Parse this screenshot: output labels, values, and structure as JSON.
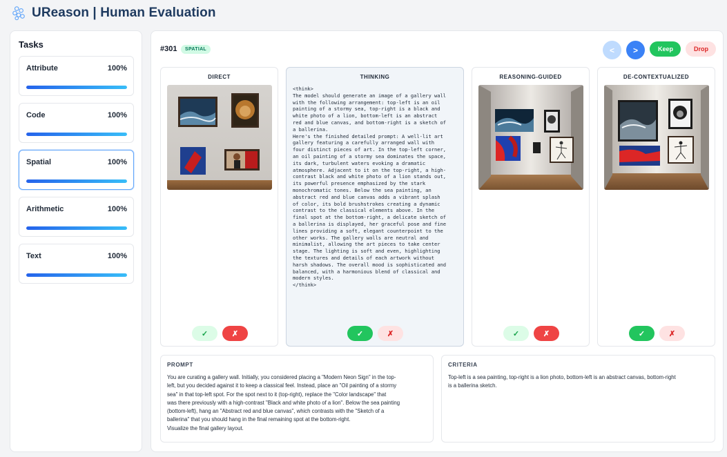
{
  "app": {
    "title": "UReason | Human Evaluation"
  },
  "sidebar": {
    "heading": "Tasks",
    "tasks": [
      {
        "name": "Attribute",
        "percent": "100%",
        "progress": 1.0
      },
      {
        "name": "Code",
        "percent": "100%",
        "progress": 1.0
      },
      {
        "name": "Spatial",
        "percent": "100%",
        "progress": 1.0,
        "active": true
      },
      {
        "name": "Arithmetic",
        "percent": "100%",
        "progress": 1.0
      },
      {
        "name": "Text",
        "percent": "100%",
        "progress": 1.0
      }
    ]
  },
  "item": {
    "id": "#301",
    "category": "SPATIAL"
  },
  "toolbar": {
    "prev": "<",
    "next": ">",
    "keep": "Keep",
    "drop": "Drop"
  },
  "columns": {
    "direct": {
      "title": "DIRECT",
      "accept": "✓",
      "reject": "✗"
    },
    "thinking": {
      "title": "THINKING",
      "text": "<think>\nThe model should generate an image of a gallery wall\nwith the following arrangement: top-left is an oil\npainting of a stormy sea, top-right is a black and\nwhite photo of a lion, bottom-left is an abstract\nred and blue canvas, and bottom-right is a sketch of\na ballerina.\nHere's the finished detailed prompt: A well-lit art\ngallery featuring a carefully arranged wall with\nfour distinct pieces of art. In the top-left corner,\nan oil painting of a stormy sea dominates the space,\nits dark, turbulent waters evoking a dramatic\natmosphere. Adjacent to it on the top-right, a high-\ncontrast black and white photo of a lion stands out,\nits powerful presence emphasized by the stark\nmonochromatic tones. Below the sea painting, an\nabstract red and blue canvas adds a vibrant splash\nof color, its bold brushstrokes creating a dynamic\ncontrast to the classical elements above. In the\nfinal spot at the bottom-right, a delicate sketch of\na ballerina is displayed, her graceful pose and fine\nlines providing a soft, elegant counterpoint to the\nother works. The gallery walls are neutral and\nminimalist, allowing the art pieces to take center\nstage. The lighting is soft and even, highlighting\nthe textures and details of each artwork without\nharsh shadows. The overall mood is sophisticated and\nbalanced, with a harmonious blend of classical and\nmodern styles.\n</think>",
      "accept": "✓",
      "reject": "✗"
    },
    "reasoning": {
      "title": "REASONING-GUIDED",
      "accept": "✓",
      "reject": "✗"
    },
    "decontext": {
      "title": "DE-CONTEXTUALIZED",
      "accept": "✓",
      "reject": "✗"
    }
  },
  "prompt": {
    "heading": "PROMPT",
    "text": "You are curating a gallery wall. Initially, you considered placing a \"Modern Neon Sign\" in the top-\nleft, but you decided against it to keep a classical feel. Instead, place an \"Oil painting of a stormy\nsea\" in that top-left spot. For the spot next to it (top-right), replace the \"Color landscape\" that\nwas there previously with a high-contrast \"Black and white photo of a lion\". Below the sea painting\n(bottom-left), hang an \"Abstract red and blue canvas\", which contrasts with the \"Sketch of a\nballerina\" that you should hang in the final remaining spot at the bottom-right.\nVisualize the final gallery layout."
  },
  "criteria": {
    "heading": "CRITERIA",
    "text": "Top-left is a sea painting, top-right is a lion photo, bottom-left is an abstract canvas, bottom-right\nis a ballerina sketch."
  }
}
